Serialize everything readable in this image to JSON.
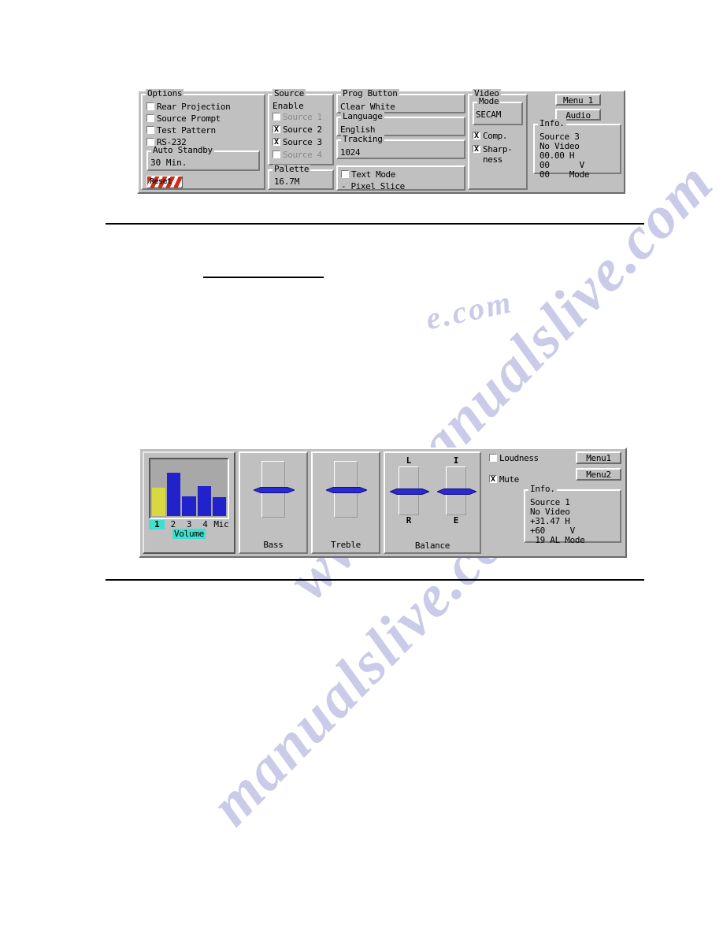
{
  "panel1": {
    "options": {
      "title": "Options",
      "checkboxes": [
        {
          "label": "Rear Projection",
          "checked": false,
          "dimmed": false
        },
        {
          "label": "Source Prompt",
          "checked": false,
          "dimmed": false
        },
        {
          "label": "Test Pattern",
          "checked": false,
          "dimmed": false
        },
        {
          "label": "RS-232",
          "checked": false,
          "dimmed": false
        }
      ],
      "auto_standby": {
        "title": "Auto Standby",
        "value": "30 Min."
      },
      "reset_label": "Reset"
    },
    "source_enable": {
      "title": "Source",
      "title2": "Enable",
      "items": [
        {
          "label": "Source  1",
          "checked": false,
          "dimmed": true
        },
        {
          "label": "Source  2",
          "checked": true,
          "dimmed": false
        },
        {
          "label": "Source  3",
          "checked": true,
          "dimmed": false
        },
        {
          "label": "Source  4",
          "checked": false,
          "dimmed": true
        }
      ],
      "palette": {
        "title": "Palette",
        "value": "16.7M"
      }
    },
    "prog": {
      "prog_button": {
        "title": "Prog Button",
        "value": "Clear White"
      },
      "language": {
        "title": "Language",
        "value": "English"
      },
      "tracking": {
        "title": "Tracking",
        "value": "1024"
      },
      "text_mode": {
        "label": "Text Mode",
        "checked": false
      },
      "pixel_slice": "- Pixel Slice"
    },
    "video": {
      "title": "Video",
      "mode": {
        "title": "Mode",
        "value": "SECAM"
      },
      "checkboxes": [
        {
          "label": "Comp.",
          "checked": true
        },
        {
          "label": "Sharp-\nness",
          "checked": true
        }
      ]
    },
    "buttons": [
      {
        "label": "Menu 1"
      },
      {
        "label": "Audio"
      }
    ],
    "info": {
      "title": "Info.",
      "lines": [
        "Source 3",
        "No Video",
        "00.00 H",
        "00      V",
        "00    Mode"
      ]
    }
  },
  "panel2": {
    "volume": {
      "caption": "Volume",
      "ticks": [
        "1",
        "2",
        "3",
        "4",
        "Mic"
      ],
      "selected_index": 0,
      "bar_color": "#2222cc",
      "selected_bar_color": "#d8d840",
      "levels": [
        52,
        78,
        36,
        55,
        34
      ]
    },
    "sliders": [
      {
        "label": "Bass",
        "position": 50
      },
      {
        "label": "Treble",
        "position": 50
      }
    ],
    "balance": {
      "caption": "Balance",
      "channels": [
        {
          "top": "L",
          "bottom": "R",
          "position": 50
        },
        {
          "top": "I",
          "bottom": "E",
          "position": 50
        }
      ]
    },
    "checkboxes": [
      {
        "label": "Loudness",
        "checked": false
      },
      {
        "label": "Mute",
        "checked": true
      }
    ],
    "buttons": [
      {
        "label": "Menu1"
      },
      {
        "label": "Menu2"
      }
    ],
    "info": {
      "title": "Info.",
      "lines": [
        "Source 1",
        "No Video",
        "+31.47 H",
        "+60     V",
        " 19 AL Mode"
      ]
    }
  },
  "watermark": {
    "line1": "www.manualslive.com",
    "line2": "manualslive.com",
    "line3": "e.com"
  }
}
